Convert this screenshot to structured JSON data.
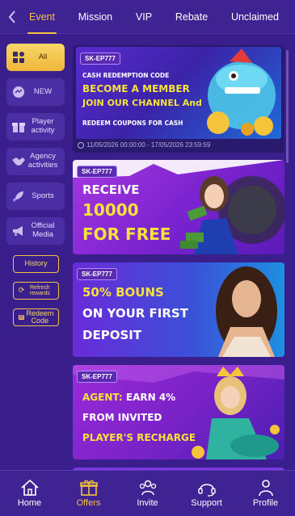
{
  "topbar": {
    "tabs": [
      {
        "label": "Event",
        "active": true
      },
      {
        "label": "Mission",
        "active": false
      },
      {
        "label": "VIP",
        "active": false
      },
      {
        "label": "Rebate",
        "active": false
      },
      {
        "label": "Unclaimed",
        "active": false
      }
    ]
  },
  "sidebar": {
    "items": [
      {
        "label": "All",
        "icon": "grid-icon",
        "active": true
      },
      {
        "label": "NEW",
        "icon": "chat-icon"
      },
      {
        "label": "Player activity",
        "icon": "gift-icon"
      },
      {
        "label": "Agency activities",
        "icon": "handshake-icon"
      },
      {
        "label": "Sports",
        "icon": "rocket-icon"
      },
      {
        "label": "Official Media",
        "icon": "megaphone-icon"
      }
    ],
    "buttons": {
      "history": "History",
      "refresh": "Refresh rewards",
      "redeem": "Redeem Code"
    }
  },
  "banners": [
    {
      "tag": "SK-EP777",
      "heading": "CASH REDEMPTION CODE",
      "line1": "BECOME A MEMBER",
      "line2": "JOIN OUR CHANNEL And",
      "line3": "REDEEM COUPONS FOR CASH",
      "date_range": "11/05/2026 00:00:00 - 17/05/2026 23:59:59"
    },
    {
      "tag": "SK-EP777",
      "line1": "RECEIVE",
      "line2": "10000",
      "line3": "FOR FREE"
    },
    {
      "tag": "SK-EP777",
      "line1": "50% BOUNS",
      "line2": "ON YOUR FIRST",
      "line3": "DEPOSIT"
    },
    {
      "tag": "SK-EP777",
      "line1a": "AGENT: ",
      "line1b": "EARN 4%",
      "line2": "FROM INVITED",
      "line3": "PLAYER'S RECHARGE"
    }
  ],
  "bottomnav": {
    "items": [
      {
        "label": "Home",
        "icon": "home-icon"
      },
      {
        "label": "Offers",
        "icon": "gift-icon",
        "active": true
      },
      {
        "label": "Invite",
        "icon": "people-icon"
      },
      {
        "label": "Support",
        "icon": "headset-icon"
      },
      {
        "label": "Profile",
        "icon": "person-icon"
      }
    ]
  },
  "colors": {
    "accent": "#f3c23c",
    "background": "#3a1f8c",
    "nav": "#3f2392"
  }
}
